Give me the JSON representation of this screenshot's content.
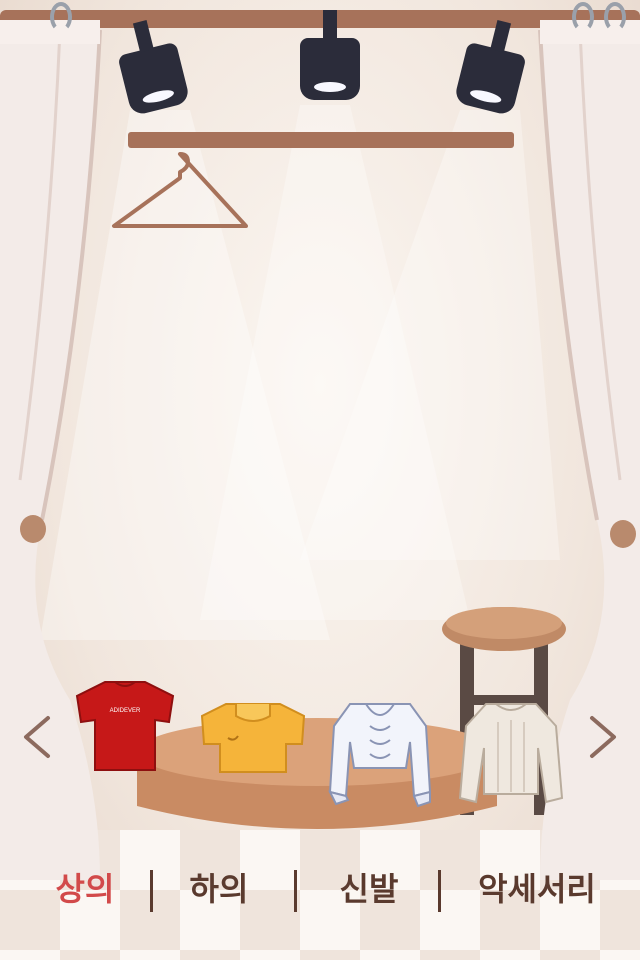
{
  "tabs": [
    {
      "label": "상의",
      "active": true
    },
    {
      "label": "하의",
      "active": false
    },
    {
      "label": "신발",
      "active": false
    },
    {
      "label": "악세서리",
      "active": false
    }
  ],
  "items": [
    {
      "name": "red t-shirt",
      "color": "#c61818",
      "print": "ADIDEVER"
    },
    {
      "name": "yellow t-shirt",
      "color": "#f5b43a"
    },
    {
      "name": "white ruffle blouse",
      "color": "#f2f4fb"
    },
    {
      "name": "cream knit sweater",
      "color": "#efe8df"
    }
  ],
  "colors": {
    "active_tab": "#d24a4a",
    "inactive_tab": "#5a3a2e",
    "wood": "#a7725a"
  },
  "icons": [
    "arrow-left-icon",
    "arrow-right-icon",
    "hanger-icon",
    "spotlight-icon"
  ]
}
